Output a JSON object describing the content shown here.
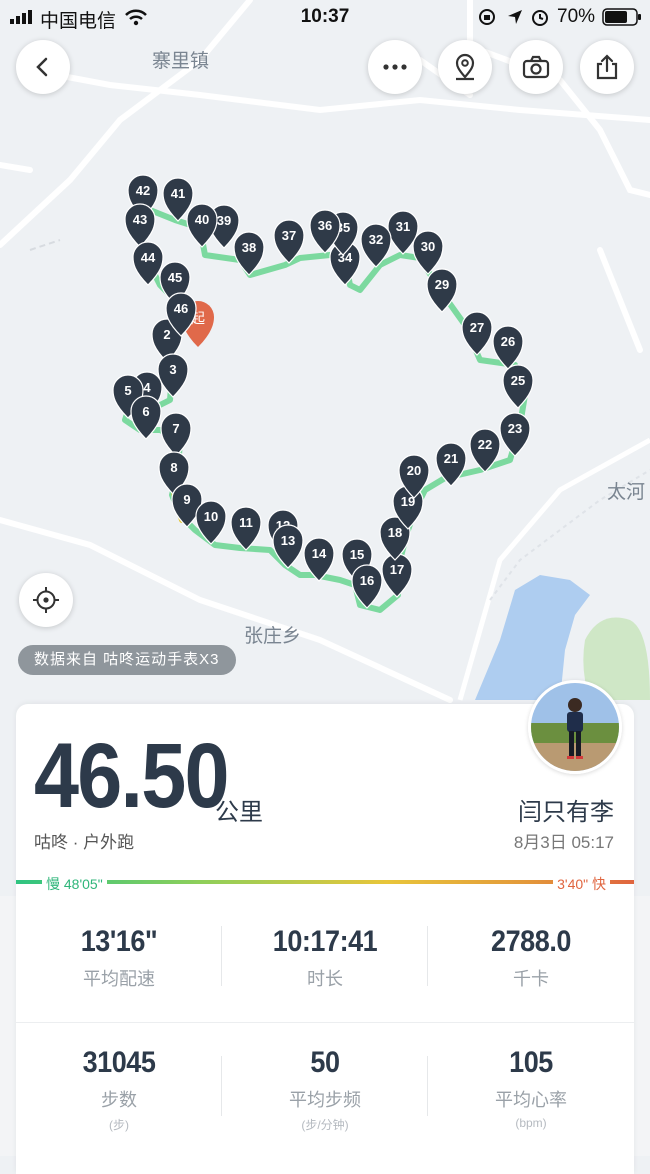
{
  "status_bar": {
    "carrier": "中国电信",
    "time": "10:37",
    "battery": "70%"
  },
  "map": {
    "labels": [
      "寨里镇",
      "张庄乡",
      "太河"
    ],
    "markers": [
      "2",
      "3",
      "4",
      "5",
      "6",
      "7",
      "8",
      "9",
      "10",
      "11",
      "12",
      "13",
      "14",
      "15",
      "16",
      "17",
      "18",
      "19",
      "20",
      "21",
      "22",
      "23",
      "25",
      "26",
      "27",
      "29",
      "30",
      "31",
      "32",
      "34",
      "35",
      "36",
      "37",
      "38",
      "39",
      "40",
      "41",
      "42",
      "43",
      "44",
      "45",
      "46"
    ],
    "start_marker": "起",
    "data_source": "数据来自 咕咚运动手表X3"
  },
  "toolbar": {
    "back_icon": "chevron-left-icon",
    "more_icon": "more-dots-icon",
    "location_icon": "map-pin-icon",
    "camera_icon": "camera-icon",
    "share_icon": "share-icon",
    "locate_icon": "crosshair-icon"
  },
  "summary": {
    "distance": "46.50",
    "unit": "公里",
    "sport": "咕咚 · 户外跑",
    "user_name": "闫只有李",
    "date": "8月3日 05:17"
  },
  "pace_scale": {
    "slow": "慢 48'05\"",
    "fast": "3'40\" 快",
    "colors": [
      "#2fc481",
      "#8fcf5a",
      "#e8c53a",
      "#e39a3a",
      "#e0653f"
    ]
  },
  "stats": [
    {
      "value": "13'16\"",
      "label": "平均配速",
      "sub": ""
    },
    {
      "value": "10:17:41",
      "label": "时长",
      "sub": ""
    },
    {
      "value": "2788.0",
      "label": "千卡",
      "sub": ""
    },
    {
      "value": "31045",
      "label": "步数",
      "sub": "(步)"
    },
    {
      "value": "50",
      "label": "平均步频",
      "sub": "(步/分钟)"
    },
    {
      "value": "105",
      "label": "平均心率",
      "sub": "(bpm)"
    }
  ]
}
